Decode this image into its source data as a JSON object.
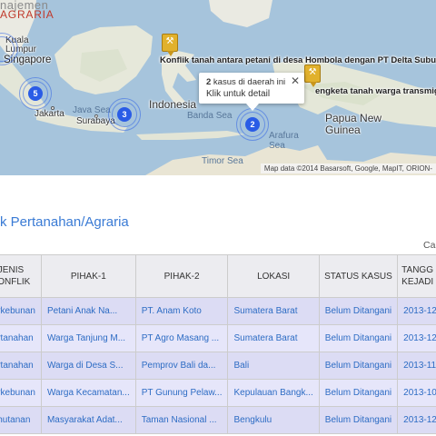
{
  "header": {
    "logo_line1": "najemen",
    "logo_line2": "AGRARIA"
  },
  "map": {
    "labels": {
      "kuala_lumpur": "Kuala\nLumpur",
      "singapore": "Singapore",
      "indonesia": "Indonesia",
      "jakarta": "Jakarta",
      "surabaya": "Surabaya",
      "java_sea": "Java Sea",
      "banda_sea": "Banda Sea",
      "arafura_sea": "Arafura\nSea",
      "timor_sea": "Timor Sea",
      "papua_new_guinea": "Papua New\nGuinea"
    },
    "clusters": [
      {
        "count": "5"
      },
      {
        "count": "3"
      },
      {
        "count": "2"
      }
    ],
    "markers": [
      {
        "title": "Konflik tanah antara petani di desa Hombola dengan PT Delta Subur Permai (DS"
      },
      {
        "title": "engketa tanah warga transmigasi di Di"
      }
    ],
    "tooltip": {
      "count": "2",
      "text": " kasus di daerah ini",
      "link": "Klik untuk detail",
      "close": "✕"
    },
    "attribution": "Map data ©2014 Basarsoft, Google, MapIT, ORION-"
  },
  "section_title": "k Pertanahan/Agraria",
  "search_label": "Ca",
  "table": {
    "headers": [
      "JENIS\nKONFLIK",
      "PIHAK-1",
      "PIHAK-2",
      "LOKASI",
      "STATUS KASUS",
      "TANGG\nKEJADI"
    ],
    "rows": [
      [
        "Perkebunan",
        "Petani Anak Na...",
        "PT. Anam Koto",
        "Sumatera Barat",
        "Belum Ditangani",
        "2013-12-"
      ],
      [
        "Pertanahan",
        "Warga Tanjung M...",
        "PT Agro Masang ...",
        "Sumatera Barat",
        "Belum Ditangani",
        "2013-12-"
      ],
      [
        "Pertanahan",
        "Warga di Desa S...",
        "Pemprov Bali da...",
        "Bali",
        "Belum Ditangani",
        "2013-11-"
      ],
      [
        "Perkebunan",
        "Warga Kecamatan...",
        "PT Gunung Pelaw...",
        "Kepulauan Bangk...",
        "Belum Ditangani",
        "2013-10-"
      ],
      [
        "Kehutanan",
        "Masyarakat Adat...",
        "Taman Nasional ...",
        "Bengkulu",
        "Belum Ditangani",
        "2013-12-"
      ]
    ]
  }
}
